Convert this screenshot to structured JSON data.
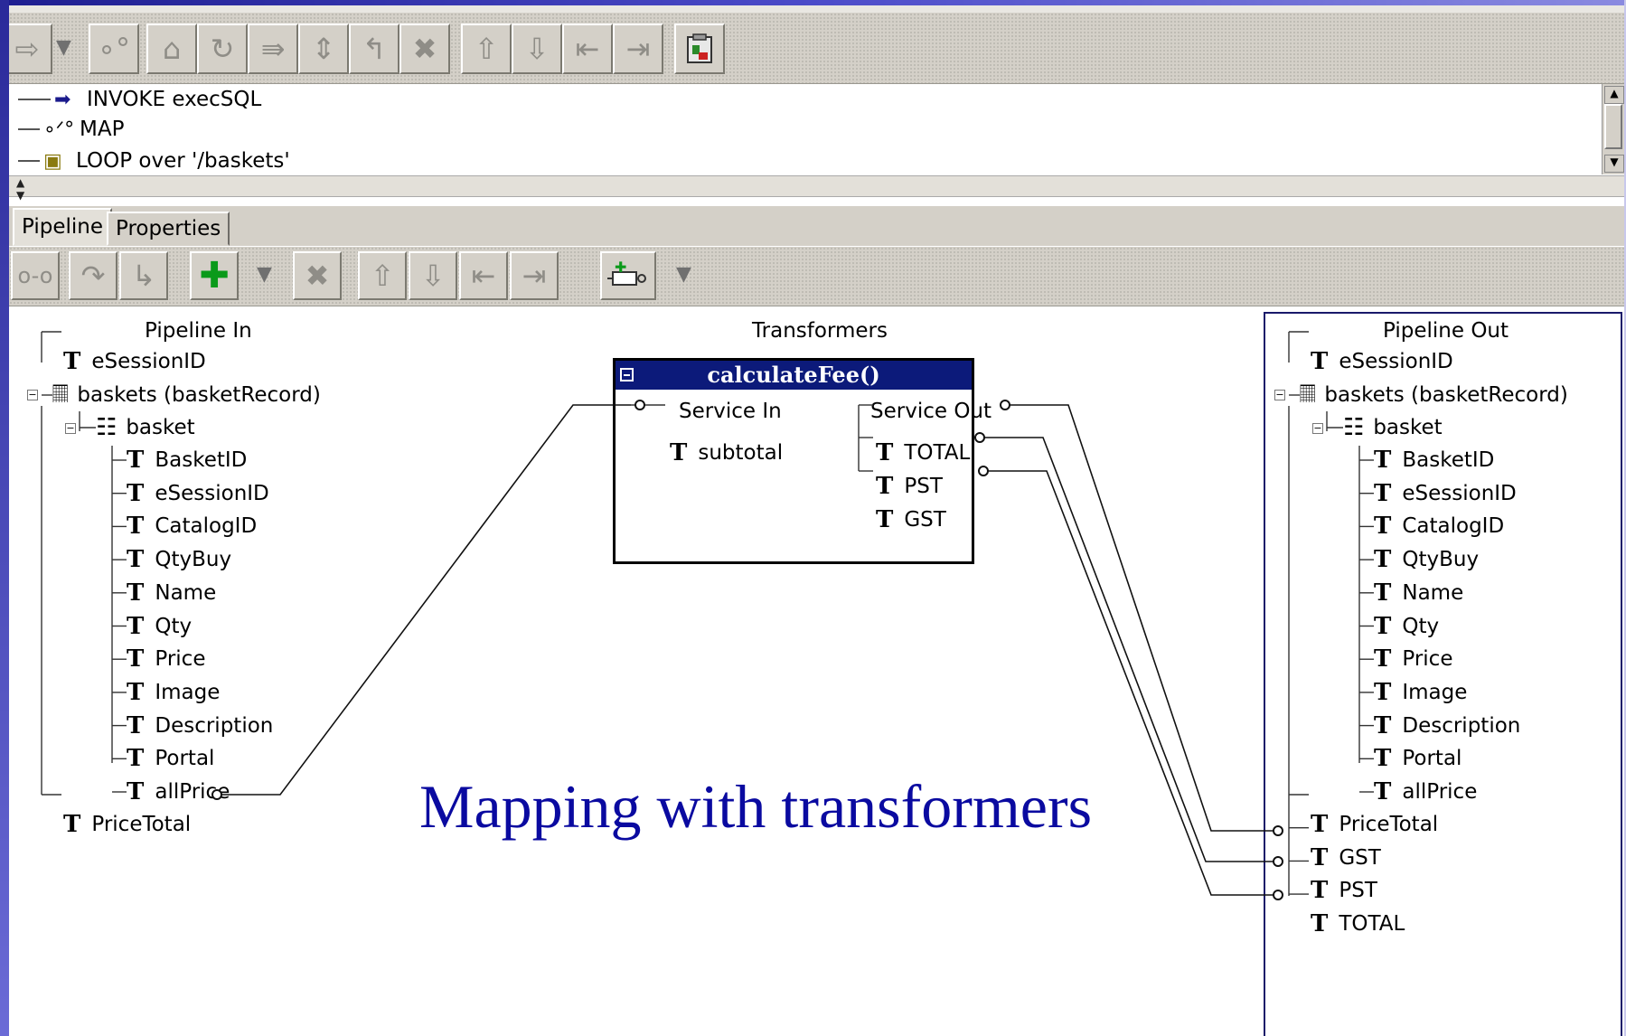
{
  "caption": "Mapping with transformers",
  "flow_steps": [
    {
      "icon": "invoke-icon",
      "label": "INVOKE execSQL"
    },
    {
      "icon": "map-icon",
      "label": "MAP"
    },
    {
      "icon": "loop-icon",
      "label": "LOOP over '/baskets'"
    }
  ],
  "tabs": [
    {
      "label": "Pipeline",
      "active": true
    },
    {
      "label": "Properties",
      "active": false
    }
  ],
  "columns": {
    "pipeline_in": "Pipeline In",
    "transformers": "Transformers",
    "pipeline_out": "Pipeline Out"
  },
  "pipeline_in": {
    "top": [
      {
        "name": "eSessionID"
      },
      {
        "name": "baskets (basketRecord)"
      },
      {
        "name": "basket"
      }
    ],
    "basket_fields": [
      "BasketID",
      "eSessionID",
      "CatalogID",
      "QtyBuy",
      "Name",
      "Qty",
      "Price",
      "Image",
      "Description",
      "Portal",
      "allPrice"
    ],
    "bottom": [
      "PriceTotal"
    ]
  },
  "transformer": {
    "title": "calculateFee()",
    "service_in_label": "Service In",
    "service_out_label": "Service Out",
    "inputs": [
      "subtotal"
    ],
    "outputs": [
      "TOTAL",
      "PST",
      "GST"
    ]
  },
  "pipeline_out": {
    "top": [
      {
        "name": "eSessionID"
      },
      {
        "name": "baskets (basketRecord)"
      },
      {
        "name": "basket"
      }
    ],
    "basket_fields": [
      "BasketID",
      "eSessionID",
      "CatalogID",
      "QtyBuy",
      "Name",
      "Qty",
      "Price",
      "Image",
      "Description",
      "Portal",
      "allPrice"
    ],
    "bottom": [
      "PriceTotal",
      "GST",
      "PST",
      "TOTAL"
    ]
  },
  "colors": {
    "title_bar": "#0c1a7a",
    "caption": "#0a0aa0",
    "toolbar": "#d4d0c8"
  }
}
